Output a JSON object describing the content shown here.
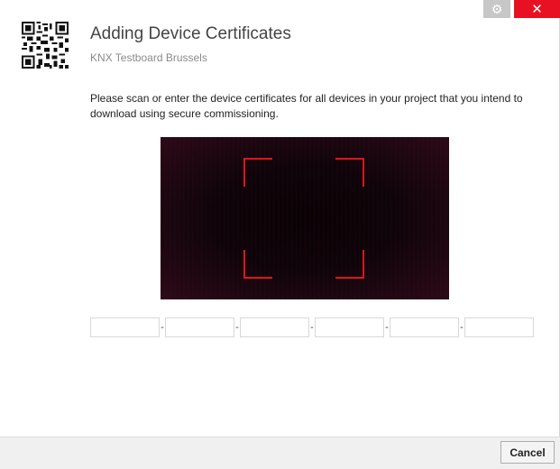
{
  "window": {
    "settings_icon": "gear-icon",
    "close_icon": "close-icon",
    "close_glyph": "✕",
    "settings_glyph": "⚙"
  },
  "header": {
    "title": "Adding Device Certificates",
    "subtitle": "KNX Testboard Brussels",
    "qr_icon": "qr-code-icon"
  },
  "instructions": "Please scan or enter the device certificates for all devices in your project that you intend to download using secure commissioning.",
  "certificate": {
    "fields": [
      "",
      "",
      "",
      "",
      "",
      ""
    ],
    "separator": "-"
  },
  "footer": {
    "cancel_label": "Cancel"
  },
  "colors": {
    "close": "#e81123",
    "scan_frame": "#e0141e"
  }
}
